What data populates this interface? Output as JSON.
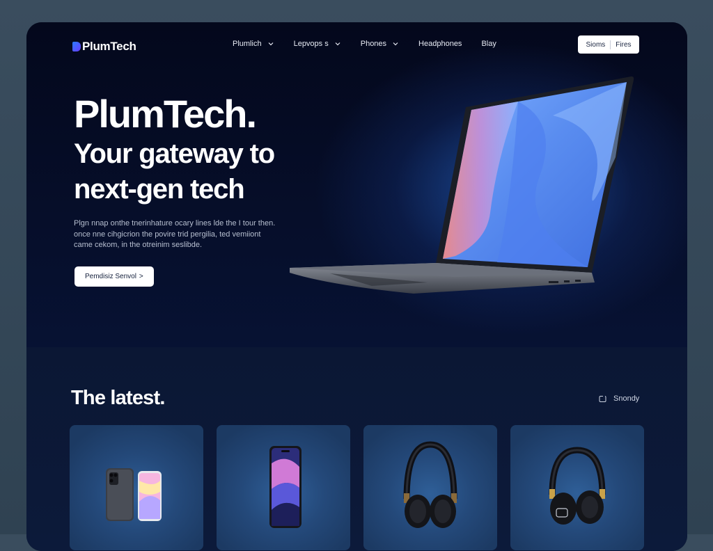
{
  "brand": {
    "name": "PlumTech"
  },
  "nav": {
    "items": [
      {
        "label": "Plumlich",
        "has_dropdown": true
      },
      {
        "label": "Lepvops s",
        "has_dropdown": true
      },
      {
        "label": "Phones",
        "has_dropdown": true
      },
      {
        "label": "Headphones",
        "has_dropdown": false
      },
      {
        "label": "Blay",
        "has_dropdown": false
      }
    ],
    "actions": {
      "primary": "Sioms",
      "secondary": "Fires"
    }
  },
  "hero": {
    "title": "PlumTech.",
    "subtitle_line1": "Your gateway to",
    "subtitle_line2": "next-gen tech",
    "description_line1": "Plgn nnap onthe tnerinhature ocary lines lde the I tour then.",
    "description_line2": "once nne cihgicrion the povire trid pergilia, ted vemiiont",
    "description_line3": "came cekom, in the otreinim seslibde.",
    "cta_label": "Pemdisiz Senvol",
    "cta_arrow": ">"
  },
  "latest": {
    "title": "The latest.",
    "filter_label": "Snondy",
    "filter_icon": "filter-icon",
    "cards": [
      {
        "icon": "phone-pair-icon"
      },
      {
        "icon": "phone-icon"
      },
      {
        "icon": "headphones-icon"
      },
      {
        "icon": "headphones-gold-icon"
      }
    ]
  },
  "colors": {
    "background": "#050a1f",
    "accent": "#2a7cff",
    "card": "#24497a"
  }
}
